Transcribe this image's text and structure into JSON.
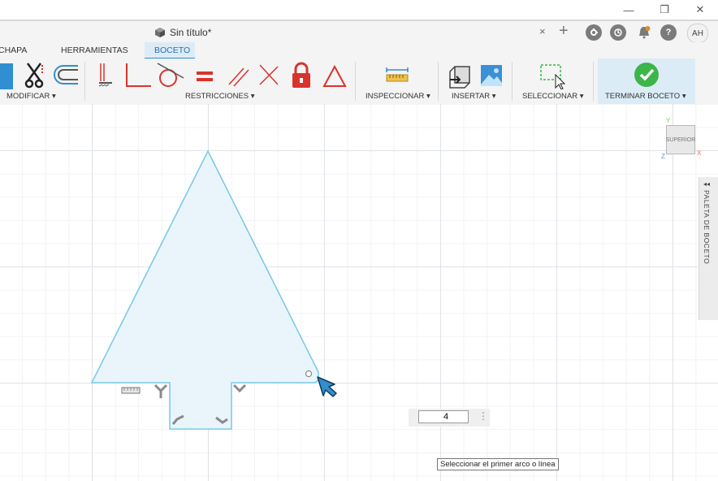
{
  "window": {
    "title": "Sin título*",
    "minimize_glyph": "—",
    "restore_glyph": "❐",
    "close_glyph": "✕"
  },
  "tabbar": {
    "close_glyph": "×",
    "new_tab_glyph": "+",
    "avatar": "AH",
    "icons": [
      "extensions-icon",
      "job-status-icon",
      "notifications-icon",
      "help-icon"
    ]
  },
  "ribbon": {
    "tabs": [
      "CHAPA",
      "HERRAMIENTAS",
      "BOCETO"
    ],
    "active_tab": "BOCETO"
  },
  "toolbar": {
    "groups": {
      "modificar": "MODIFICAR ▾",
      "restricciones": "RESTRICCIONES ▾",
      "inspeccionar": "INSPECCIONAR ▾",
      "insertar": "INSERTAR ▾",
      "seleccionar": "SELECCIONAR ▾",
      "terminar": "TERMINAR BOCETO ▾"
    }
  },
  "viewcube": {
    "face": "SUPERIOR",
    "axis_x": "X",
    "axis_y": "Y",
    "axis_z": "Z"
  },
  "palette": {
    "label": "PALETA DE BOCETO",
    "collapse_glyph": "◂◂"
  },
  "dimension_input": {
    "value": "4",
    "more_glyph": "⋮"
  },
  "tooltip": {
    "text": "Seleccionar el primer arco o línea"
  },
  "colors": {
    "sketch_line": "#7ccbe6",
    "sketch_fill": "#eaf5fb",
    "accent_blue": "#2f8fd0",
    "finish_green": "#3cb54a",
    "constraint_red": "#d9332b"
  }
}
